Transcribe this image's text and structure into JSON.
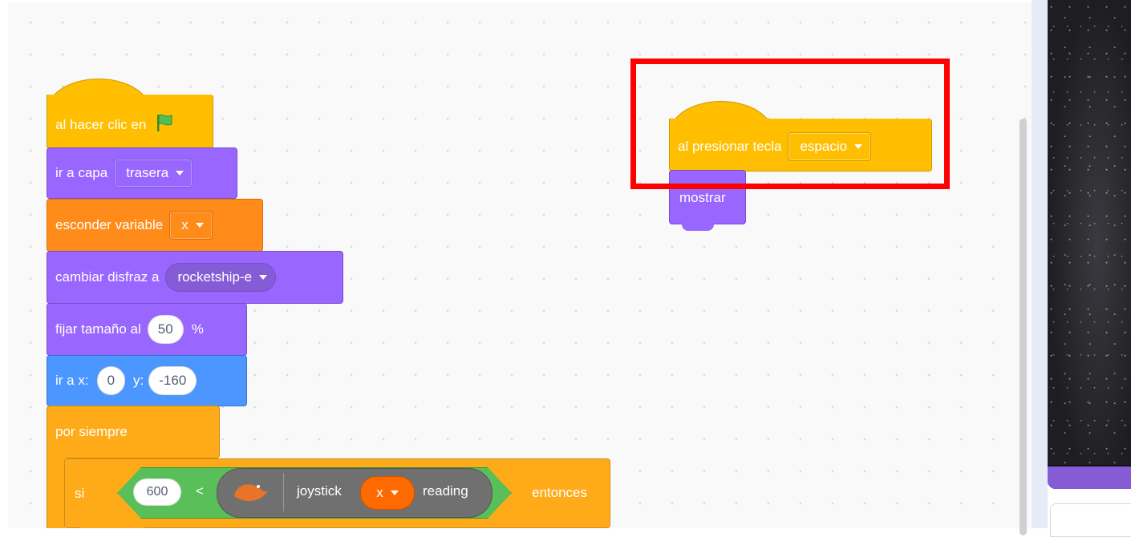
{
  "blocks": {
    "flag_hat": {
      "label": "al hacer clic en",
      "icon": "green-flag-icon"
    },
    "go_layer": {
      "label": "ir a capa",
      "dropdown": "trasera"
    },
    "hide_var": {
      "label": "esconder variable",
      "dropdown": "x"
    },
    "switch_costume": {
      "label": "cambiar disfraz a",
      "dropdown": "rocketship-e"
    },
    "set_size": {
      "label": "fijar tamaño al",
      "value": "50",
      "suffix": "%"
    },
    "go_to_xy": {
      "label": "ir a x:",
      "x_value": "0",
      "y_label": "y:",
      "y_value": "-160"
    },
    "forever": {
      "label": "por siempre"
    },
    "if_block": {
      "label": "si",
      "then_label": "entonces",
      "compare_value": "600",
      "operator": "<",
      "ext_label": "joystick",
      "ext_dropdown": "x",
      "ext_reading": "reading"
    },
    "key_hat": {
      "label": "al presionar tecla",
      "dropdown": "espacio"
    },
    "show": {
      "label": "mostrar"
    }
  },
  "colors": {
    "events": "#ffbf00",
    "looks": "#9966ff",
    "variables": "#ff8c1a",
    "motion": "#4c97ff",
    "control": "#ffab19",
    "operators": "#59c059",
    "extension": "#707070",
    "highlight": "#ff0000"
  }
}
